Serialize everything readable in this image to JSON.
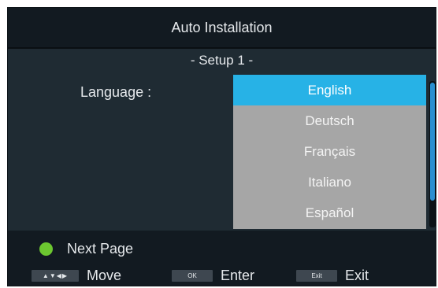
{
  "header": {
    "title": "Auto Installation"
  },
  "main": {
    "subtitle": "- Setup 1 -",
    "language_label": "Language :",
    "language_options": [
      "English",
      "Deutsch",
      "Français",
      "Italiano",
      "Español"
    ],
    "selected_language": "English"
  },
  "footer": {
    "next_page_label": "Next Page",
    "hints": [
      {
        "key": "▲▼◀▶",
        "label": "Move"
      },
      {
        "key": "OK",
        "label": "Enter"
      },
      {
        "key": "Exit",
        "label": "Exit"
      }
    ]
  },
  "colors": {
    "background": "#1f2b33",
    "title_bar": "#121a21",
    "list_background": "#a6a6a6",
    "selected_highlight": "#27b2e6",
    "next_page_dot": "#6cc730",
    "scroll_thumb": "#2a8fd0"
  }
}
